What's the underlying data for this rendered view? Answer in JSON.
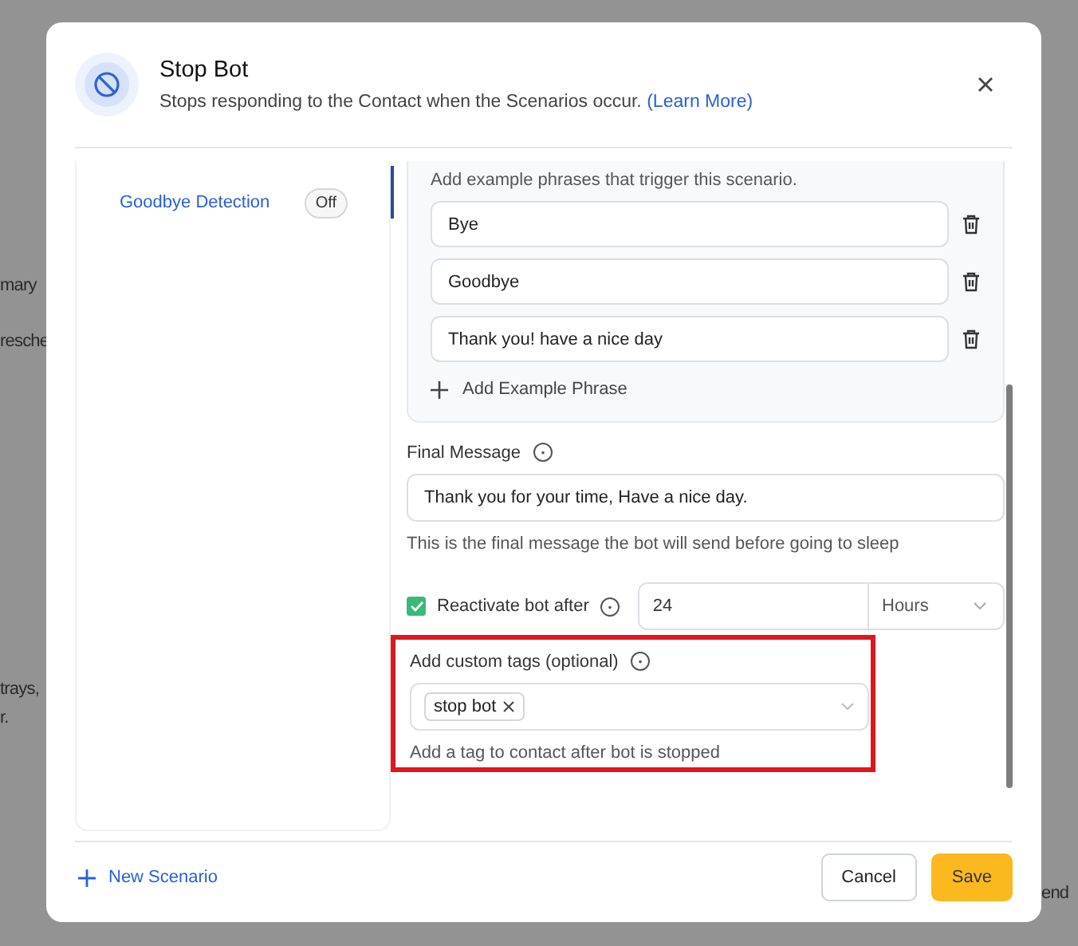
{
  "background_text": [
    "mary",
    "resche",
    "trays,",
    "r.",
    "end"
  ],
  "header": {
    "title": "Stop Bot",
    "subtitle": "Stops responding to the Contact when the Scenarios occur.",
    "link": "(Learn More)"
  },
  "scenarios": [
    {
      "name": "Goodbye Detection",
      "status": "Off",
      "on": false,
      "selected": true
    }
  ],
  "phrases": {
    "hint": "Add example phrases that trigger this scenario.",
    "items": [
      "Bye",
      "Goodbye",
      "Thank you! have a nice day"
    ],
    "add": "Add Example Phrase"
  },
  "final_message": {
    "label": "Final Message",
    "value": "Thank you for your time, Have a nice day.",
    "help": "This is the final message the bot will send before going to sleep"
  },
  "reactivate": {
    "label": "Reactivate bot after",
    "checked": true,
    "value": "24",
    "unit": "Hours"
  },
  "tags": {
    "label": "Add custom tags (optional)",
    "chips": [
      "stop bot"
    ],
    "help": "Add a tag to contact after bot is stopped"
  },
  "footer": {
    "new_scenario": "New Scenario",
    "buttons": [
      {
        "label": "Cancel",
        "kind": "secondary"
      },
      {
        "label": "Save",
        "kind": "primary"
      }
    ]
  }
}
